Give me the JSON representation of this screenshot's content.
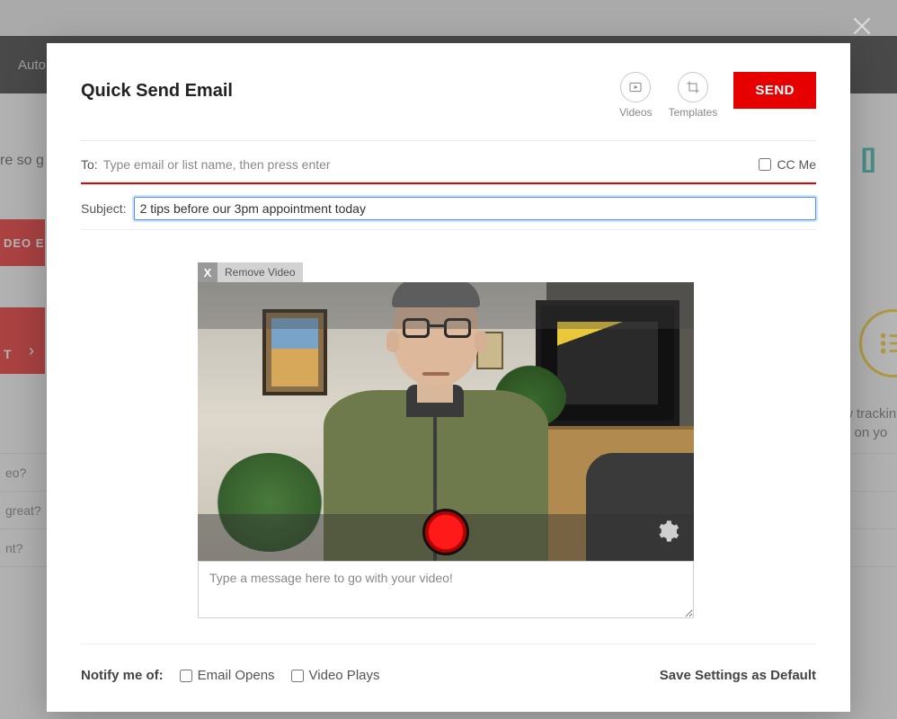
{
  "background": {
    "blackbar_text": "Auto",
    "redblock1_text": "DEO E",
    "redblock2_text": "T",
    "side_rows": [
      "eo?",
      "great?",
      "nt?"
    ],
    "left_fragment": "re so g",
    "right_bracket": "[ ]",
    "tracking_text_line1": "w trackin",
    "tracking_text_line2": "g on yo"
  },
  "modal": {
    "title": "Quick Send Email",
    "videos_label": "Videos",
    "templates_label": "Templates",
    "send_label": "SEND",
    "to_label": "To:",
    "to_placeholder": "Type email or list name, then press enter",
    "ccme_label": "CC Me",
    "subject_label": "Subject:",
    "subject_value": "2 tips before our 3pm appointment today",
    "remove_video_label": "Remove Video",
    "remove_video_x": "X",
    "message_placeholder": "Type a message here to go with your video!",
    "notify_label": "Notify me of:",
    "email_opens_label": "Email Opens",
    "video_plays_label": "Video Plays",
    "save_default_label": "Save Settings as Default"
  }
}
